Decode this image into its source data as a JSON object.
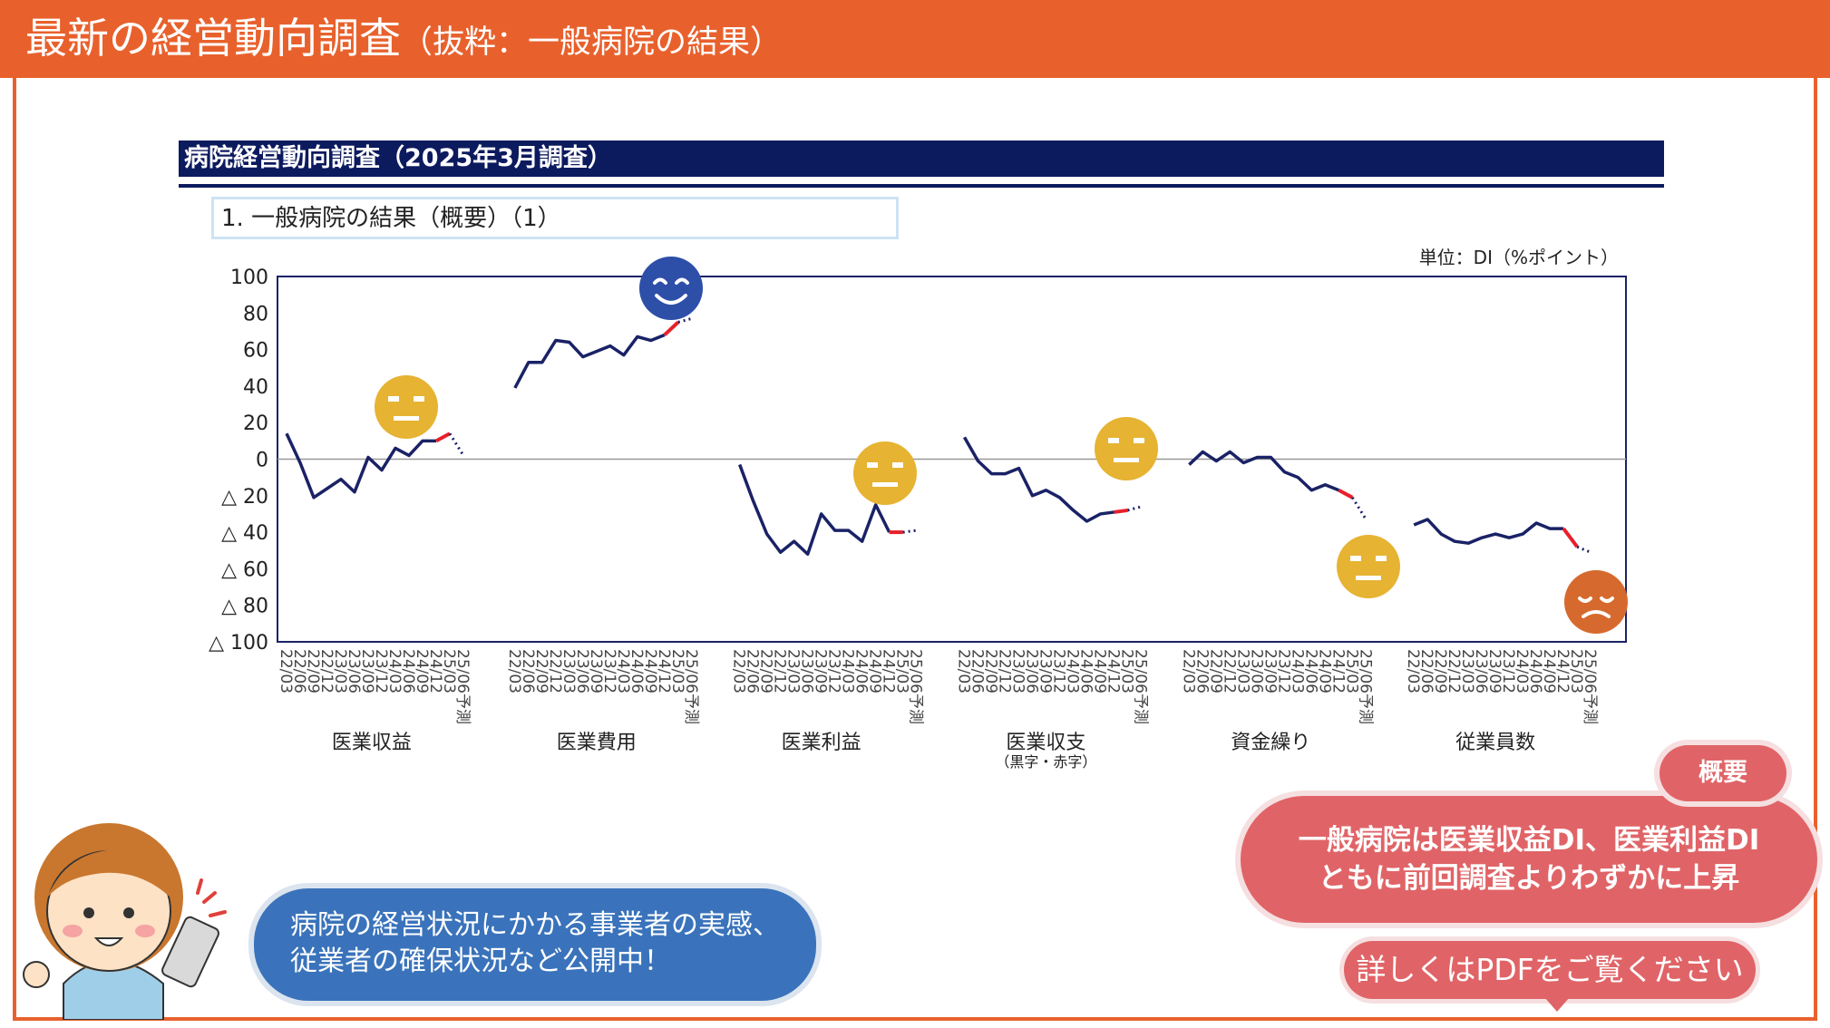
{
  "header": {
    "title": "最新の経営動向調査",
    "subtitle": "（抜粋：一般病院の結果）"
  },
  "banner": "病院経営動向調査（2025年3月調査）",
  "section_title": "1. 一般病院の結果（概要）（1）",
  "unit_label": "単位：DI（%ポイント）",
  "summary": {
    "badge": "概要",
    "line1": "一般病院は医業収益DI、医業利益DI",
    "line2": "ともに前回調査よりわずかに上昇"
  },
  "pdf_button": "詳しくはPDFをご覧ください",
  "speech": {
    "line1": "病院の経営状況にかかる事業者の実感、",
    "line2": "従業者の確保状況など公開中！"
  },
  "colors": {
    "header": "#e8612d",
    "series_line": "#1a2266",
    "latest_change": "#e8202a",
    "face_neutral": "#e6b332",
    "face_happy": "#2d4fa8",
    "face_sad": "#d66a2e",
    "bubble_red": "#e06467",
    "bubble_blue": "#3a73bb"
  },
  "chart_data": {
    "type": "line",
    "ylim": [
      -100,
      100
    ],
    "y_ticks": [
      "100",
      "80",
      "60",
      "40",
      "20",
      "0",
      "△ 20",
      "△ 40",
      "△ 60",
      "△ 80",
      "△ 100"
    ],
    "x_tick_labels": [
      "22/03",
      "22/06",
      "22/09",
      "22/12",
      "23/03",
      "23/06",
      "23/09",
      "23/12",
      "24/03",
      "24/06",
      "24/09",
      "24/12",
      "25/03",
      "25/06予測"
    ],
    "groups": [
      {
        "name": "医業収益",
        "sublabel": "",
        "face": "neutral",
        "values": [
          14,
          -2,
          -21,
          -16,
          -11,
          -18,
          1,
          -6,
          6,
          2,
          10,
          10,
          14,
          2
        ]
      },
      {
        "name": "医業費用",
        "sublabel": "",
        "face": "happy",
        "values": [
          39,
          53,
          53,
          65,
          64,
          56,
          59,
          62,
          57,
          67,
          65,
          68,
          75,
          77
        ]
      },
      {
        "name": "医業利益",
        "sublabel": "",
        "face": "neutral",
        "values": [
          -3,
          -23,
          -41,
          -51,
          -45,
          -52,
          -30,
          -39,
          -39,
          -45,
          -25,
          -40,
          -40,
          -39
        ]
      },
      {
        "name": "医業収支",
        "sublabel": "（黒字・赤字）",
        "face": "neutral",
        "values": [
          12,
          -1,
          -8,
          -8,
          -5,
          -20,
          -17,
          -21,
          -28,
          -34,
          -30,
          -29,
          -28,
          -26
        ]
      },
      {
        "name": "資金繰り",
        "sublabel": "",
        "face": "neutral",
        "values": [
          -3,
          4,
          -1,
          4,
          -2,
          1,
          1,
          -7,
          -10,
          -17,
          -14,
          -17,
          -21,
          -33
        ]
      },
      {
        "name": "従業員数",
        "sublabel": "",
        "face": "sad",
        "values": [
          -36,
          -33,
          -41,
          -45,
          -46,
          -43,
          -41,
          -43,
          -41,
          -35,
          -38,
          -38,
          -48,
          -51
        ]
      }
    ]
  }
}
